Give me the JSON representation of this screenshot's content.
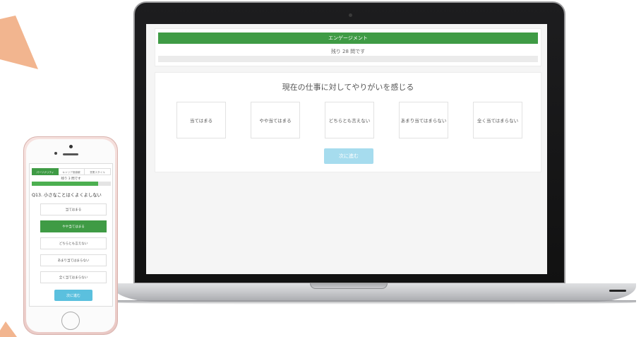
{
  "desktop": {
    "section_title": "エンゲージメント",
    "remaining_text": "残り 28 問です",
    "progress": 0,
    "question": "現在の仕事に対してやりがいを感じる",
    "options": [
      "当てはまる",
      "やや当てはまる",
      "どちらとも言えない",
      "あまり当てはまらない",
      "全く当てはまらない"
    ],
    "next_label": "次に進む"
  },
  "mobile": {
    "tabs": [
      "パーソナリティ",
      "キャリア価値観",
      "営業スタイル"
    ],
    "active_tab": 0,
    "remaining_text": "残り 3 問です",
    "progress": 0.84,
    "question": "Q13. 小さなことはくよくよしない",
    "options": [
      "当てはまる",
      "やや当てはまる",
      "どちらとも言えない",
      "あまり当てはまらない",
      "全く当てはまらない"
    ],
    "selected_option": 1,
    "next_label": "次に進む"
  },
  "colors": {
    "accent_green": "#3f9b45",
    "next_button_desktop": "#a6dcee",
    "next_button_mobile": "#5bc0de",
    "decoration_arrow": "#f2b58f"
  }
}
